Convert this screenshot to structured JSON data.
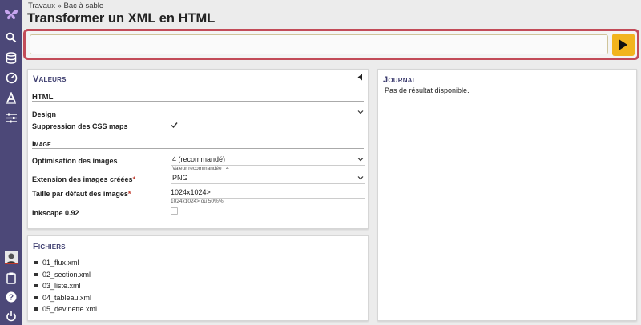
{
  "breadcrumb": "Travaux » Bac à sable",
  "title": "Transformer un XML en HTML",
  "command": {
    "value": "",
    "placeholder": ""
  },
  "sidebar": {
    "items": [
      {
        "icon": "butterfly-logo-icon"
      },
      {
        "icon": "search-icon"
      },
      {
        "icon": "database-icon"
      },
      {
        "icon": "dashboard-gauge-icon"
      },
      {
        "icon": "text-a-icon"
      },
      {
        "icon": "sliders-icon"
      },
      {
        "icon": "user-avatar-icon"
      },
      {
        "icon": "clipboard-icon"
      },
      {
        "icon": "help-icon"
      },
      {
        "icon": "power-icon"
      }
    ]
  },
  "values_panel": {
    "title": "Valeurs",
    "html_section": "HTML",
    "design_label": "Design",
    "design_value": "",
    "css_maps_label": "Suppression des CSS maps",
    "css_maps_checked": true,
    "image_section": "Image",
    "optim_label": "Optimisation des images",
    "optim_value": "4 (recommandé)",
    "optim_hint": "Valeur recommandée : 4",
    "ext_label": "Extension des images créées",
    "ext_value": "PNG",
    "size_label": "Taille par défaut des images",
    "size_value": "1024x1024>",
    "size_hint": "1024x1024> ou 50%%",
    "inkscape_label": "Inkscape 0.92",
    "inkscape_checked": false,
    "required_mark": "*"
  },
  "files_panel": {
    "title": "Fichiers",
    "items": [
      "01_flux.xml",
      "02_section.xml",
      "03_liste.xml",
      "04_tableau.xml",
      "05_devinette.xml"
    ]
  },
  "journal_panel": {
    "title": "Journal",
    "text": "Pas de résultat disponible."
  },
  "colors": {
    "sidebar": "#4c4878",
    "accent": "#c24b58",
    "run_button": "#f2b41e",
    "panel_title": "#3c3c6e"
  }
}
